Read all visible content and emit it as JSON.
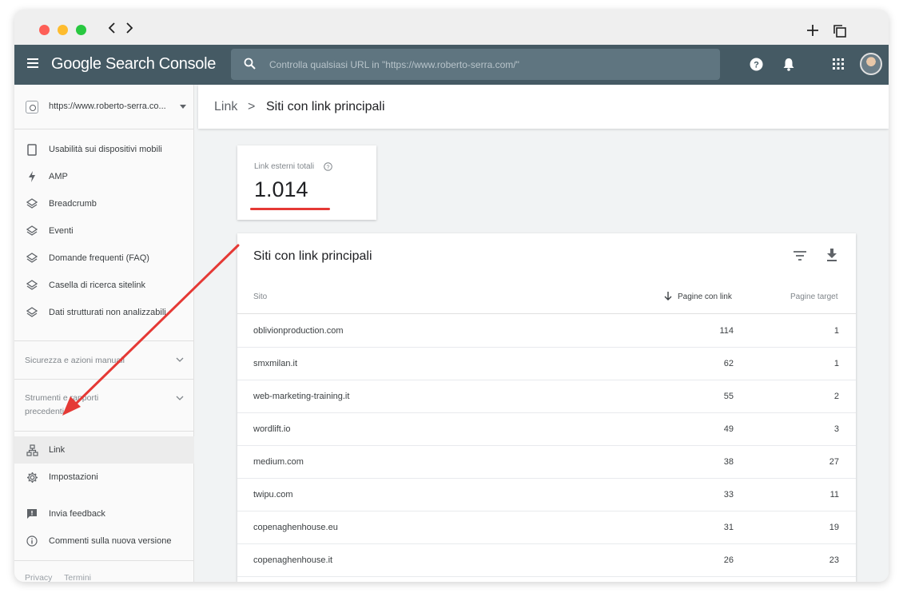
{
  "app": {
    "title": "Google Search Console",
    "search_placeholder": "Controlla qualsiasi URL in \"https://www.roberto-serra.com/\""
  },
  "sidebar": {
    "property": "https://www.roberto-serra.co...",
    "items_top": [
      {
        "label": "Usabilità sui dispositivi mobili",
        "icon": "phone-icon"
      },
      {
        "label": "AMP",
        "icon": "lightning-icon"
      },
      {
        "label": "Breadcrumb",
        "icon": "layers-icon"
      },
      {
        "label": "Eventi",
        "icon": "layers-icon"
      },
      {
        "label": "Domande frequenti (FAQ)",
        "icon": "layers-icon"
      },
      {
        "label": "Casella di ricerca sitelink",
        "icon": "layers-icon"
      },
      {
        "label": "Dati strutturati non analizzabili",
        "icon": "layers-icon"
      }
    ],
    "section_security": "Sicurezza e azioni manuali",
    "section_tools_line1": "Strumenti e rapporti",
    "section_tools_line2": "precedenti",
    "items_bottom": [
      {
        "label": "Link",
        "icon": "sitemap-icon"
      },
      {
        "label": "Impostazioni",
        "icon": "gear-icon"
      },
      {
        "label": "Invia feedback",
        "icon": "feedback-icon"
      },
      {
        "label": "Commenti sulla nuova versione",
        "icon": "info-icon"
      }
    ],
    "footer": {
      "privacy": "Privacy",
      "terms": "Termini"
    }
  },
  "breadcrumb": {
    "parent": "Link",
    "separator": ">",
    "current": "Siti con link principali"
  },
  "stat": {
    "label": "Link esterni totali",
    "value": "1.014"
  },
  "table": {
    "title": "Siti con link principali",
    "columns": {
      "site": "Sito",
      "pages": "Pagine con link",
      "target": "Pagine target"
    },
    "rows": [
      {
        "site": "oblivionproduction.com",
        "pages": "114",
        "target": "1"
      },
      {
        "site": "smxmilan.it",
        "pages": "62",
        "target": "1"
      },
      {
        "site": "web-marketing-training.it",
        "pages": "55",
        "target": "2"
      },
      {
        "site": "wordlift.io",
        "pages": "49",
        "target": "3"
      },
      {
        "site": "medium.com",
        "pages": "38",
        "target": "27"
      },
      {
        "site": "twipu.com",
        "pages": "33",
        "target": "11"
      },
      {
        "site": "copenaghenhouse.eu",
        "pages": "31",
        "target": "19"
      },
      {
        "site": "copenaghenhouse.it",
        "pages": "26",
        "target": "23"
      }
    ]
  },
  "colors": {
    "appbar": "#455a64",
    "accent_red": "#e53935"
  }
}
